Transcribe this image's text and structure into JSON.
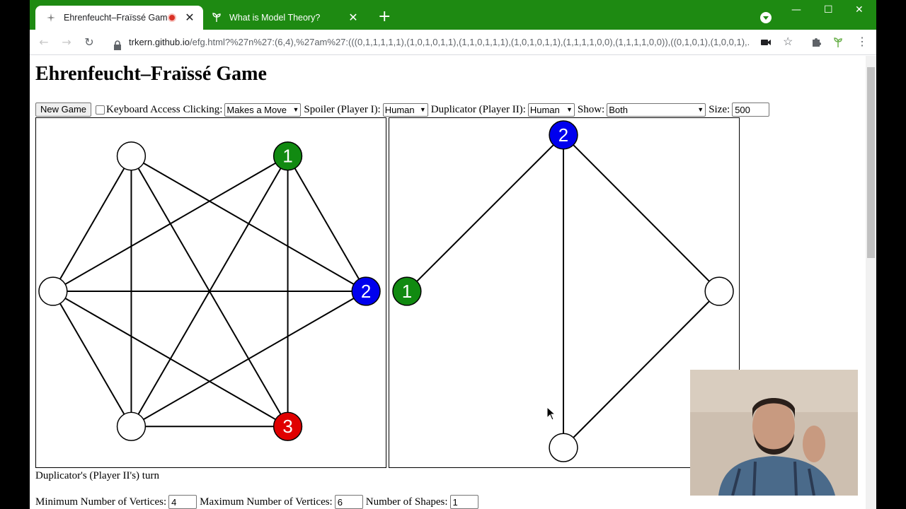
{
  "browser": {
    "tabs": [
      {
        "title": "Ehrenfeucht–Fraïssé Game",
        "active": true,
        "recording": true
      },
      {
        "title": "What is Model Theory?",
        "active": false
      }
    ],
    "new_tab_label": "+",
    "url_host": "trkern.github.io",
    "url_path": "/efg.html?%27n%27:(6,4),%27am%27:(((0,1,1,1,1,1),(1,0,1,0,1,1),(1,1,0,1,1,1),(1,0,1,0,1,1),(1,1,1,1,0,0),(1,1,1,1,0,0)),((0,1,0,1),(1,0,0,1),..."
  },
  "page": {
    "title": "Ehrenfeucht–Fraïssé Game",
    "new_game_label": "New Game",
    "keyboard_access_label": "Keyboard Access",
    "clicking_label": "Clicking:",
    "clicking_value": "Makes a Move",
    "spoiler_label": "Spoiler (Player I):",
    "spoiler_value": "Human",
    "duplicator_label": "Duplicator (Player II):",
    "duplicator_value": "Human",
    "show_label": "Show:",
    "show_value": "Both",
    "size_label": "Size:",
    "size_value": "500",
    "turn_status": "Duplicator's (Player II's) turn",
    "min_vertices_label": "Minimum Number of Vertices:",
    "min_vertices_value": "4",
    "max_vertices_label": "Maximum Number of Vertices:",
    "max_vertices_value": "6",
    "num_shapes_label": "Number of Shapes:",
    "num_shapes_value": "1"
  },
  "colors": {
    "chrome_green": "#1e8a12",
    "player1_green": "#118a11",
    "player2_blue": "#0000ee",
    "player3_red": "#e00000"
  },
  "left_graph": {
    "vertex_labels": [
      "",
      "1",
      "2",
      "3",
      "",
      ""
    ],
    "vertex_fills": [
      "#ffffff",
      "#118a11",
      "#0000ee",
      "#e00000",
      "#ffffff",
      "#ffffff"
    ],
    "edges": [
      [
        0,
        2
      ],
      [
        0,
        3
      ],
      [
        0,
        4
      ],
      [
        0,
        5
      ],
      [
        1,
        2
      ],
      [
        1,
        3
      ],
      [
        1,
        4
      ],
      [
        1,
        5
      ],
      [
        2,
        4
      ],
      [
        2,
        5
      ],
      [
        3,
        4
      ],
      [
        3,
        5
      ],
      [
        4,
        5
      ]
    ]
  },
  "right_graph": {
    "vertex_labels": [
      "2",
      "",
      "",
      "1"
    ],
    "vertex_fills": [
      "#0000ee",
      "#ffffff",
      "#ffffff",
      "#118a11"
    ],
    "edges": [
      [
        0,
        1
      ],
      [
        0,
        2
      ],
      [
        0,
        3
      ],
      [
        1,
        2
      ]
    ]
  }
}
